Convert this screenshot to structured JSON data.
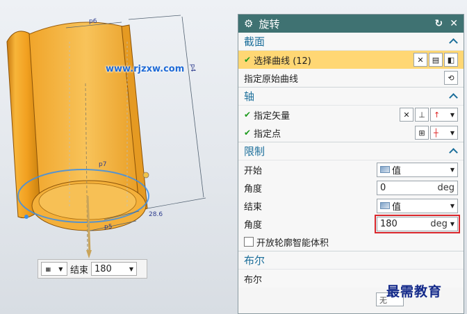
{
  "viewport": {
    "watermark": "www.rjzxw.com",
    "dimension_labels": [
      "p6",
      "p4",
      "p7",
      "p5",
      "28.6"
    ],
    "mini_toolbar": {
      "end_label": "结束",
      "end_value": "180"
    }
  },
  "dialog": {
    "title": "旋转",
    "sections": {
      "section": {
        "header": "截面",
        "select_curve_label": "选择曲线 (12)",
        "specify_origin_curve_label": "指定原始曲线"
      },
      "axis": {
        "header": "轴",
        "specify_vector_label": "指定矢量",
        "specify_point_label": "指定点"
      },
      "limits": {
        "header": "限制",
        "start_label": "开始",
        "start_option": "值",
        "start_angle_label": "角度",
        "start_angle_value": "0",
        "start_angle_unit": "deg",
        "end_label": "结束",
        "end_option": "值",
        "end_angle_label": "角度",
        "end_angle_value": "180",
        "end_angle_unit": "deg",
        "open_profile_label": "开放轮廓智能体积"
      },
      "boolean": {
        "header": "布尔",
        "boolean_label": "布尔",
        "boolean_value": "无"
      }
    }
  },
  "brand_watermark": "最需教育",
  "colors": {
    "titlebar": "#3f7272",
    "section_header": "#1b6e9a",
    "selected_row": "#ffd774",
    "highlight": "#d9262b",
    "model": "#f2a020"
  }
}
